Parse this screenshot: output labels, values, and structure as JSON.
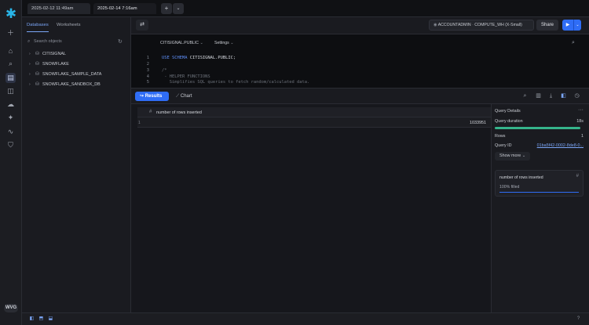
{
  "file_tabs": [
    {
      "label": "2025-02-12 11:49am"
    },
    {
      "label": "2025-02-14 7:16am"
    }
  ],
  "browser": {
    "tabs": [
      "Databases",
      "Worksheets"
    ],
    "search_placeholder": "Search objects",
    "databases": [
      "CITISIGNAL",
      "SNOWFLAKE",
      "SNOWFLAKE_SAMPLE_DATA",
      "SNOWFLAKE_SANDBOX_DB"
    ]
  },
  "header": {
    "role": "ACCOUNTADMIN",
    "warehouse": "COMPUTE_WH (X-Small)",
    "share_label": "Share"
  },
  "editor": {
    "context": "CITISIGNAL.PUBLIC",
    "settings_label": "Settings",
    "lines": [
      {
        "n": "1",
        "kw": "USE SCHEMA",
        "tx": " CITISIGNAL.PUBLIC;"
      },
      {
        "n": "2",
        "kw": "",
        "tx": ""
      },
      {
        "n": "3",
        "cm": "/*"
      },
      {
        "n": "4",
        "cm": " - HELPER FUNCTIONS"
      },
      {
        "n": "5",
        "cm": "   Simplifies SQL queries to fetch random/calculated data."
      }
    ]
  },
  "results": {
    "results_label": "Results",
    "chart_label": "Chart",
    "column_header": "number of rows inserted",
    "row_number": "1",
    "value": "1033951"
  },
  "details": {
    "title": "Query Details",
    "duration_label": "Query duration",
    "duration_value": "18s",
    "duration_fill": 1.0,
    "rows_label": "Rows",
    "rows_value": "1",
    "query_id_label": "Query ID",
    "query_id_value": "01ba5f42-0002-8de8-0...",
    "show_more_label": "Show more",
    "card_title": "number of rows inserted",
    "card_filled": "100% filled"
  },
  "user": {
    "initials": "WVG"
  },
  "colors": {
    "accent": "#2f6df6",
    "progress": "#35b48b",
    "brand": "#29b5e8"
  }
}
